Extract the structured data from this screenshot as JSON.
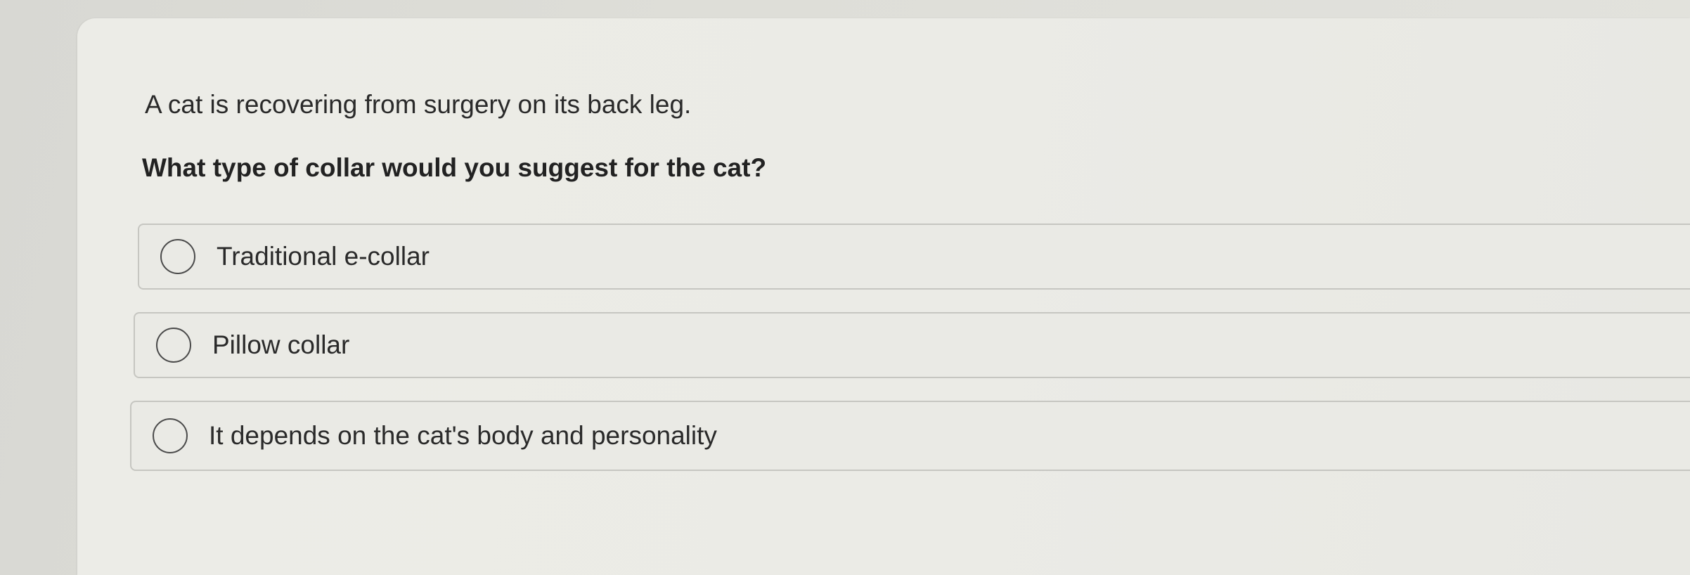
{
  "question": {
    "text": "A cat is recovering from surgery on its back leg.",
    "prompt": "What type of collar would you suggest for the cat?",
    "options": [
      {
        "label": "Traditional e-collar",
        "selected": false
      },
      {
        "label": "Pillow collar",
        "selected": false
      },
      {
        "label": "It depends on the cat's body and personality",
        "selected": false
      }
    ]
  }
}
